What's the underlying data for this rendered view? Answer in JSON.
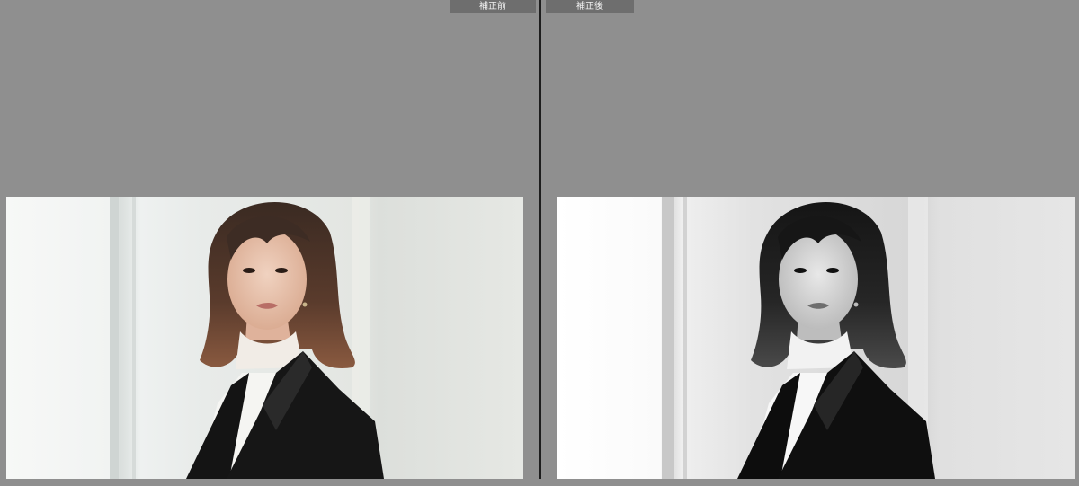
{
  "panes": {
    "before": {
      "label": "補正前",
      "mode": "color"
    },
    "after": {
      "label": "補正後",
      "mode": "monochrome"
    }
  },
  "colors": {
    "background": "#8f8f8f",
    "label_bg": "#6e6e6e",
    "divider": "#1d1d1d"
  },
  "icons": []
}
